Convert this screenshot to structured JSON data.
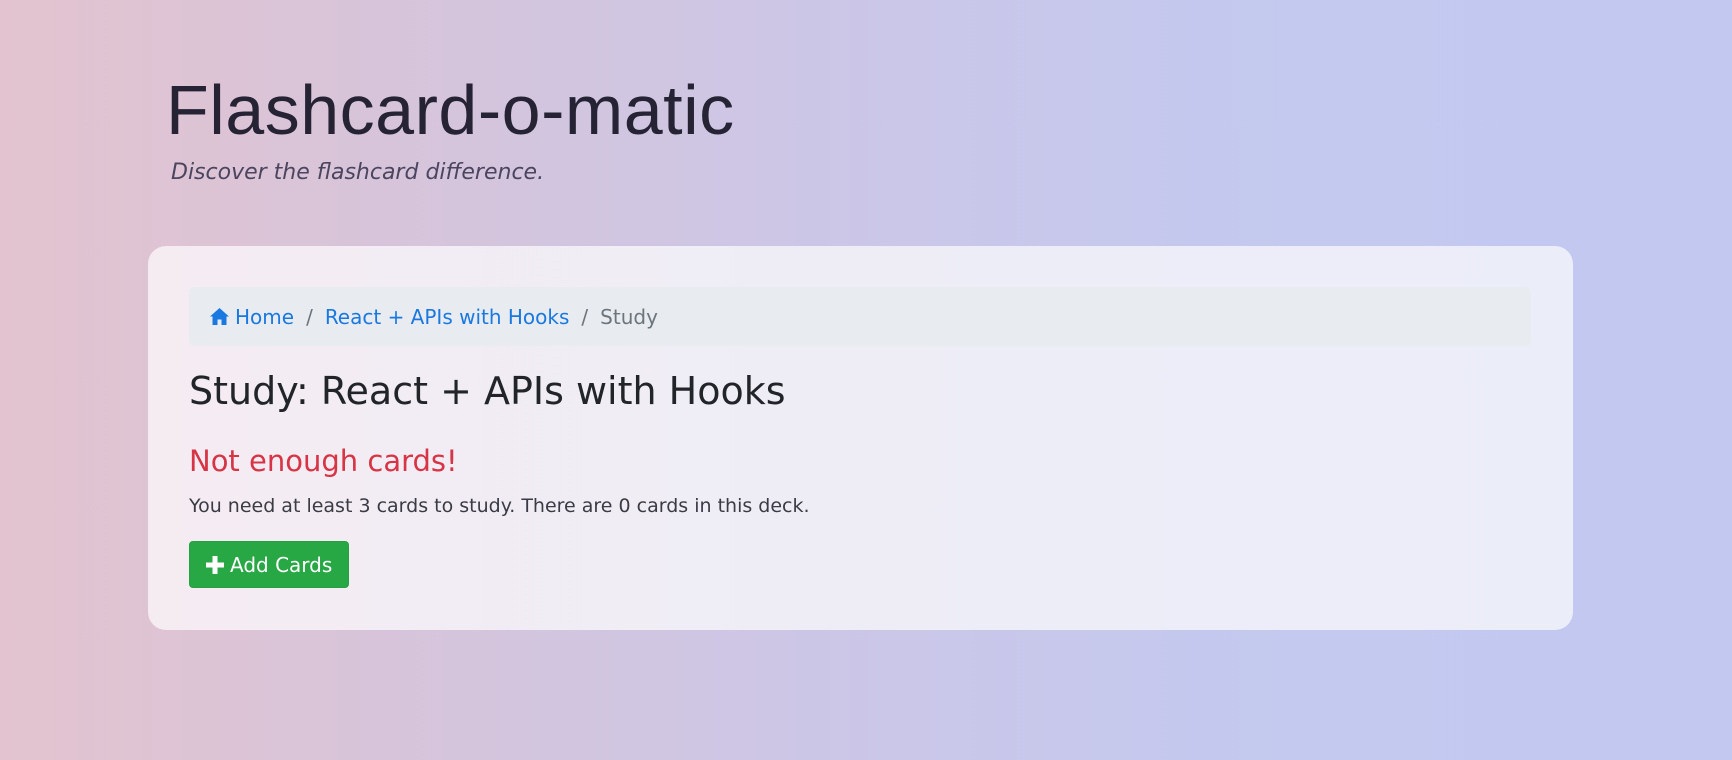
{
  "header": {
    "title": "Flashcard-o-matic",
    "tagline": "Discover the flashcard difference."
  },
  "breadcrumb": {
    "home_icon": "home-icon",
    "home_label": "Home",
    "deck_label": "React + APIs with Hooks",
    "current_label": "Study",
    "separator": "/"
  },
  "study": {
    "title": "Study: React + APIs with Hooks",
    "warning_title": "Not enough cards!",
    "warning_text": "You need at least 3 cards to study. There are 0 cards in this deck.",
    "add_button_icon": "plus-icon",
    "add_button_label": "Add Cards"
  },
  "colors": {
    "link": "#1a79e0",
    "danger": "#d73445",
    "success": "#28a745"
  }
}
